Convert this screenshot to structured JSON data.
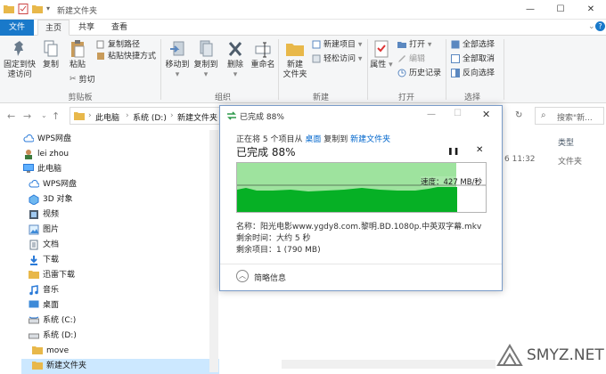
{
  "window": {
    "title": "新建文件夹",
    "controls": {
      "minimize": "—",
      "maximize": "☐",
      "close": "✕"
    }
  },
  "tabs": {
    "file": "文件",
    "home": "主页",
    "share": "共享",
    "view": "查看"
  },
  "ribbon": {
    "pin_label_1": "固定到快",
    "pin_label_2": "速访问",
    "copy": "复制",
    "paste": "粘贴",
    "copy_path": "复制路径",
    "paste_shortcut": "粘贴快捷方式",
    "cut": "剪切",
    "group_clipboard": "剪贴板",
    "move_to": "移动到",
    "copy_to": "复制到",
    "delete": "删除",
    "rename": "重命名",
    "group_organize": "组织",
    "new_folder_1": "新建",
    "new_folder_2": "文件夹",
    "new_item": "新建项目",
    "easy_access": "轻松访问",
    "group_new": "新建",
    "properties": "属性",
    "open": "打开",
    "edit": "编辑",
    "history": "历史记录",
    "group_open": "打开",
    "select_all": "全部选择",
    "select_none": "全部取消",
    "invert_select": "反向选择",
    "group_select": "选择"
  },
  "address": {
    "crumbs": [
      "此电脑",
      "系统 (D:)",
      "新建文件夹"
    ],
    "search_placeholder": "搜索\"新..."
  },
  "nav_items": [
    {
      "label": "WPS网盘",
      "icon": "cloud-icon"
    },
    {
      "label": "lei zhou",
      "icon": "user-icon"
    },
    {
      "label": "此电脑",
      "icon": "computer-icon"
    },
    {
      "label": "WPS网盘",
      "icon": "cloud-icon"
    },
    {
      "label": "3D 对象",
      "icon": "cube-icon"
    },
    {
      "label": "视频",
      "icon": "video-icon"
    },
    {
      "label": "图片",
      "icon": "picture-icon"
    },
    {
      "label": "文档",
      "icon": "document-icon"
    },
    {
      "label": "下载",
      "icon": "download-icon"
    },
    {
      "label": "迅雷下载",
      "icon": "folder-icon"
    },
    {
      "label": "音乐",
      "icon": "music-icon"
    },
    {
      "label": "桌面",
      "icon": "desktop-icon"
    },
    {
      "label": "系统 (C:)",
      "icon": "drive-icon"
    },
    {
      "label": "系统 (D:)",
      "icon": "drive-icon"
    },
    {
      "label": "move",
      "icon": "folder-icon"
    },
    {
      "label": "新建文件夹",
      "icon": "folder-icon"
    }
  ],
  "file_list": {
    "col_type": "类型",
    "row_time": "6 11:32",
    "row_type": "文件夹"
  },
  "dialog": {
    "title": "已完成 88%",
    "status_prefix": "正在将 5 个项目从",
    "source": "桌面",
    "status_mid": "复制到",
    "dest": "新建文件夹",
    "progress_text": "已完成 88%",
    "pause": "❚❚",
    "cancel": "✕",
    "speed": "速度：427 MB/秒",
    "name_line": "名称：阳光电影www.ygdy8.com.黎明.BD.1080p.中英双字幕.mkv",
    "time_left": "剩余时间：大约 5 秒",
    "items_left": "剩余项目：1 (790 MB)",
    "less_details": "简略信息",
    "progress": 0.88
  },
  "watermark": "SMYZ.NET",
  "colors": {
    "accent": "#1979ca",
    "progress_fill": "#9ee39e",
    "progress_dark": "#06b025",
    "select_bg": "#cce8ff"
  }
}
